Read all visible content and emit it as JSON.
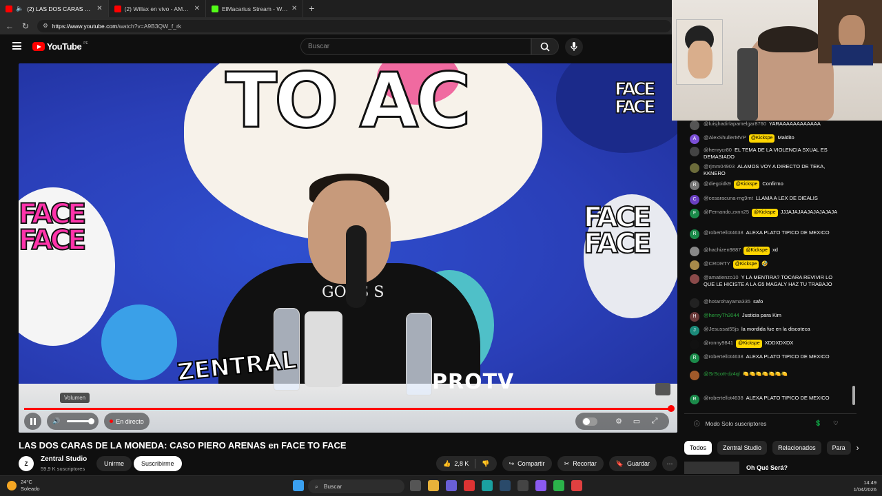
{
  "browser": {
    "tabs": [
      {
        "label": "(2) LAS DOS CARAS DE LA M",
        "active": true,
        "color": "#ff0000"
      },
      {
        "label": "(2) Willax en vivo - AMOR Y FUEGO",
        "active": false,
        "color": "#ff0000"
      },
      {
        "label": "ElMacarius Stream - Watch Live on",
        "active": false,
        "color": "#53fc18"
      }
    ],
    "url_host": "https://www.youtube.com",
    "url_path": "/watch?v=A9B3QW_f_rk"
  },
  "youtube": {
    "logo_text": "YouTube",
    "country_code": "PE",
    "search_placeholder": "Buscar"
  },
  "video": {
    "title": "LAS DOS CARAS DE LA MONEDA: CASO PIERO ARENAS en FACE TO FACE",
    "live_label": "En directo",
    "volume_tooltip": "Volumen",
    "overlay_left_top": "TO AC",
    "overlay_face1": "FACE TO FACE",
    "brand_zentral": "ZENTRAL",
    "brand_protv": "PROTV",
    "shirt_text": "GODS S",
    "progress": 1.0
  },
  "channel": {
    "name": "Zentral Studio",
    "subscribers": "59,9 K suscriptores",
    "join_label": "Unirme",
    "subscribe_label": "Suscribirme",
    "likes": "2,8 K",
    "share_label": "Compartir",
    "clip_label": "Recortar",
    "save_label": "Guardar"
  },
  "chat": {
    "messages": [
      {
        "user": "@luisjhadirlapamelgar8760",
        "badge": "",
        "text": "YARAAAAAAAAAAAA",
        "avatar_color": "#555",
        "avatar_letter": ""
      },
      {
        "user": "@AlexShullerMVP",
        "badge": "@Kickspe",
        "text": "Maldito",
        "avatar_color": "#7b4fd6",
        "avatar_letter": "A"
      },
      {
        "user": "@henrycr80",
        "badge": "",
        "text": "EL TEMA DE LA VIOLENCIA SXUAL ES DEMASIADO",
        "avatar_color": "#444",
        "avatar_letter": ""
      },
      {
        "user": "@rjmm04903",
        "badge": "",
        "text": "ALAMOS VOY A DIRECTO DE TEKA, KKNERO",
        "avatar_color": "#6b6b3a",
        "avatar_letter": ""
      },
      {
        "user": "@diegoidk9",
        "badge": "@Kickspe",
        "text": "Confirmo",
        "avatar_color": "#777",
        "avatar_letter": "R"
      },
      {
        "user": "@cesaracuna-mg9mt",
        "badge": "",
        "text": "LLAMA A LEX DE DIEALIS",
        "avatar_color": "#6a3fc1",
        "avatar_letter": "C"
      },
      {
        "user": "@Fernando.zxnn25",
        "badge": "@Kickspe",
        "text": "JJJAJAJAAJAJAJAJAJA",
        "avatar_color": "#1b8a4a",
        "avatar_letter": "F"
      },
      {
        "user": "@robertellot4638",
        "badge": "",
        "text": "ALEXA PLATO TIPICO DE MEXICO",
        "avatar_color": "#1b8a4a",
        "avatar_letter": "R"
      },
      {
        "user": "@hachizen9887",
        "badge": "@Kickspe",
        "text": "xd",
        "avatar_color": "#888",
        "avatar_letter": ""
      },
      {
        "user": "@CRDRTY",
        "badge": "@Kickspe",
        "text": "🤣",
        "avatar_color": "#a88a4a",
        "avatar_letter": ""
      },
      {
        "user": "@amatienzo10",
        "badge": "",
        "text": "Y LA MENTIRA? TOCARA REVIVIR LO QUE LE HICISTE A LA G5 MAGALY HAZ TU TRABAJO",
        "avatar_color": "#8a4a4a",
        "avatar_letter": ""
      },
      {
        "user": "@hotarohayama335",
        "badge": "",
        "text": "safo",
        "avatar_color": "#222",
        "avatar_letter": ""
      },
      {
        "user": "@henryTh3044",
        "badge": "",
        "text": "Justicia para Kim",
        "avatar_color": "#6b3a3a",
        "avatar_letter": "H",
        "green": true
      },
      {
        "user": "@Jesussat55js",
        "badge": "",
        "text": "la mordida fue en la discoteca",
        "avatar_color": "#1b8a7a",
        "avatar_letter": "J"
      },
      {
        "user": "@ronny9841",
        "badge": "@Kickspe",
        "text": "XDDXDXDX",
        "avatar_color": "#111",
        "avatar_letter": ""
      },
      {
        "user": "@robertellot4638",
        "badge": "",
        "text": "ALEXA PLATO TIPICO DE MEXICO",
        "avatar_color": "#1b8a4a",
        "avatar_letter": "R"
      },
      {
        "user": "@SrScott-dz4ql",
        "badge": "",
        "text": "🍋🍋🍋🍋🍋🍋🍋",
        "avatar_color": "#a05a2a",
        "avatar_letter": "",
        "green": true
      },
      {
        "user": "@robertellot4638",
        "badge": "",
        "text": "ALEXA PLATO TIPICO DE MEXICO",
        "avatar_color": "#1b8a4a",
        "avatar_letter": "R"
      }
    ],
    "footer_label": "Modo Solo suscriptores"
  },
  "related": {
    "chips": [
      "Todos",
      "Zentral Studio",
      "Relacionados",
      "Para"
    ],
    "first_title": "Oh Qué Será?"
  },
  "taskbar": {
    "temperature": "24°C",
    "weather": "Soleado",
    "search_placeholder": "Buscar",
    "time": "14:49",
    "date": "1/04/2026"
  }
}
